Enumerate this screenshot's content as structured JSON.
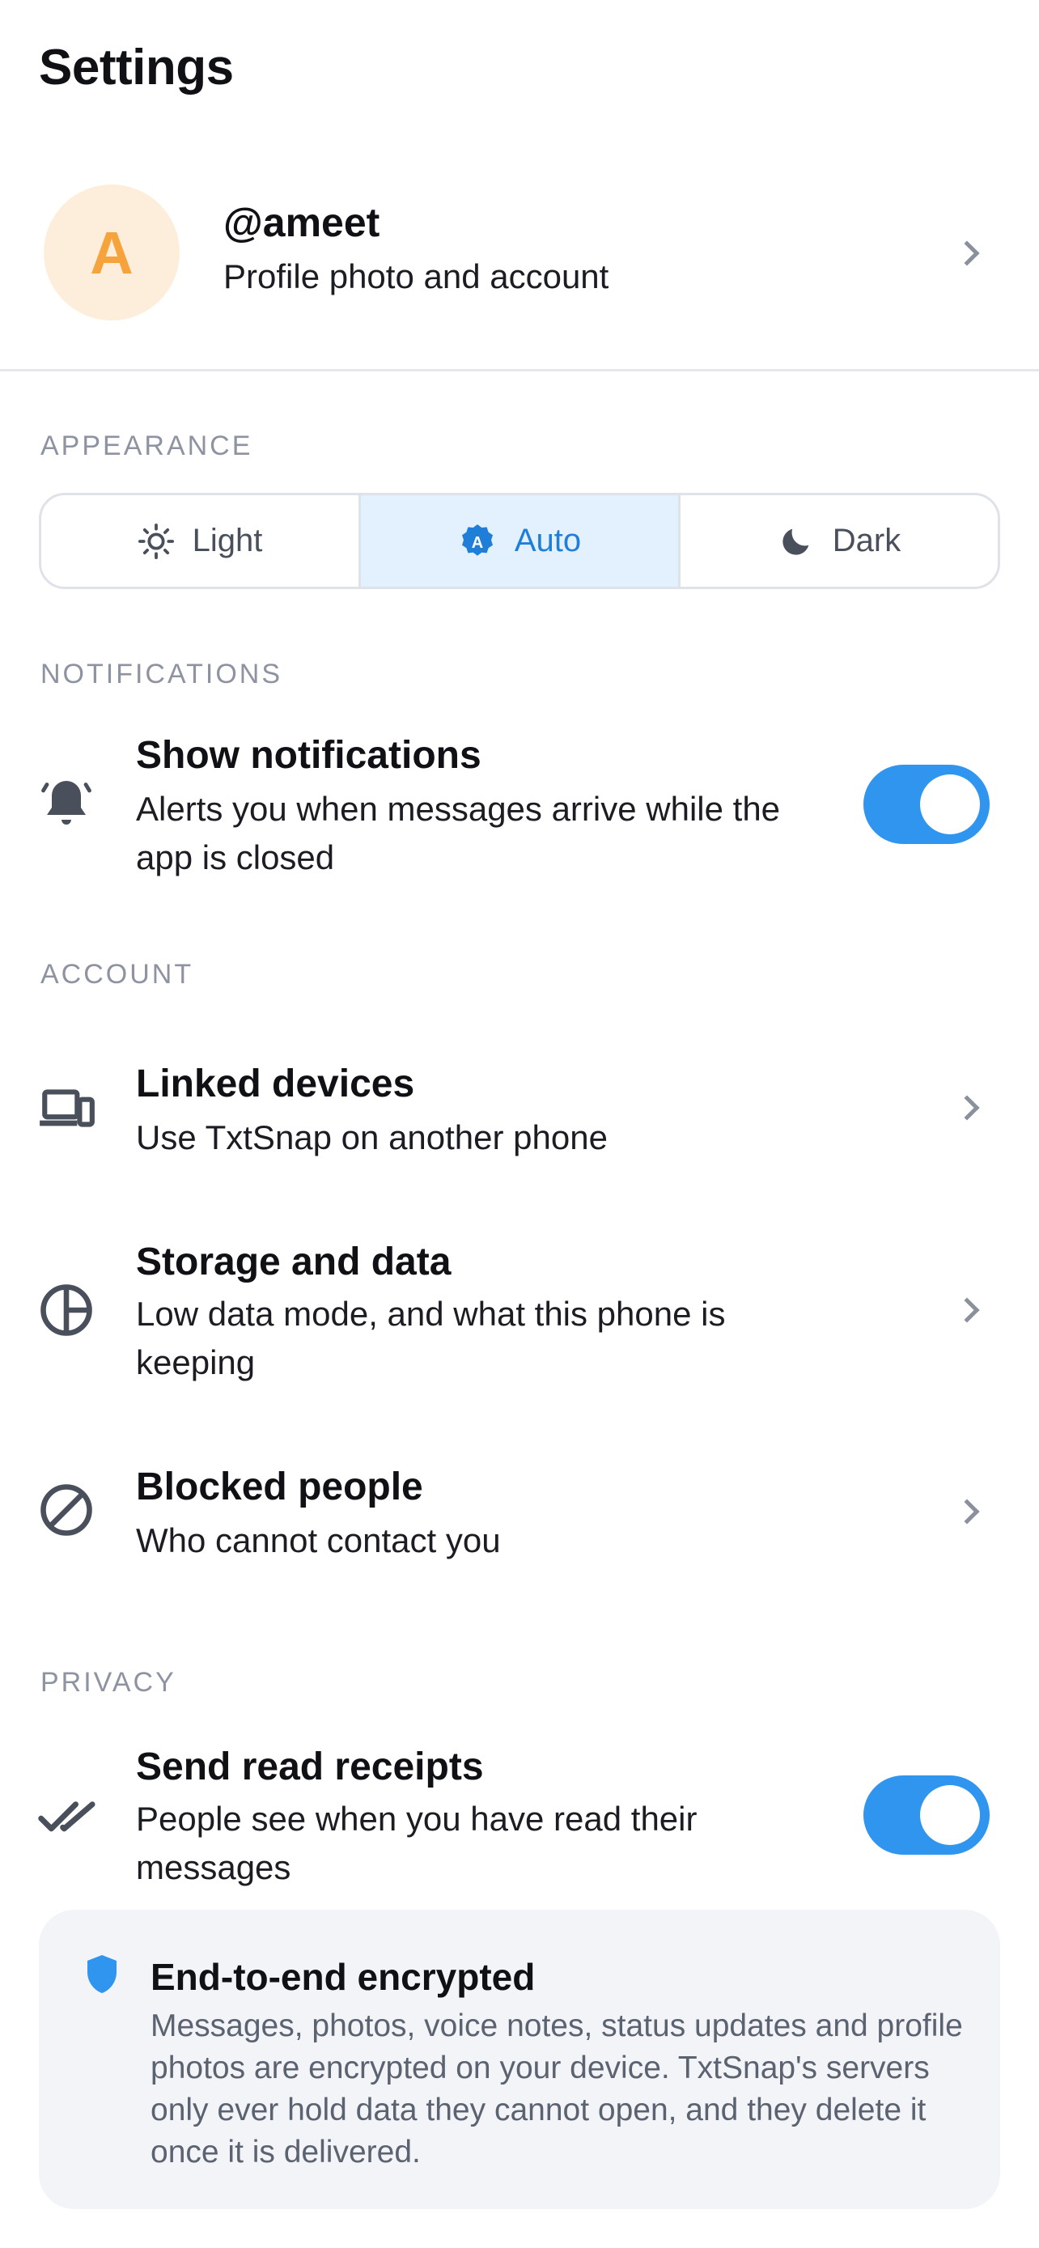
{
  "header": {
    "title": "Settings"
  },
  "profile": {
    "avatar_letter": "A",
    "username": "@ameet",
    "subtitle": "Profile photo and account"
  },
  "appearance": {
    "label": "APPEARANCE",
    "options": [
      {
        "label": "Light",
        "icon": "sun-icon"
      },
      {
        "label": "Auto",
        "icon": "auto-badge-icon",
        "selected": true
      },
      {
        "label": "Dark",
        "icon": "moon-icon"
      }
    ]
  },
  "notifications": {
    "label": "NOTIFICATIONS",
    "show": {
      "title": "Show notifications",
      "subtitle": "Alerts you when messages arrive while the app is closed",
      "enabled": true,
      "icon": "bell-icon"
    }
  },
  "account": {
    "label": "ACCOUNT",
    "items": [
      {
        "title": "Linked devices",
        "subtitle": "Use TxtSnap on another phone",
        "icon": "devices-icon"
      },
      {
        "title": "Storage and data",
        "subtitle": "Low data mode, and what this phone is keeping",
        "icon": "pie-chart-icon"
      },
      {
        "title": "Blocked people",
        "subtitle": "Who cannot contact you",
        "icon": "block-icon"
      }
    ]
  },
  "privacy": {
    "label": "PRIVACY",
    "read_receipts": {
      "title": "Send read receipts",
      "subtitle": "People see when you have read their messages",
      "enabled": true,
      "icon": "double-check-icon"
    }
  },
  "encryption": {
    "title": "End-to-end encrypted",
    "body": "Messages, photos, voice notes, status updates and profile photos are encrypted on your device. TxtSnap's servers only ever hold data they cannot open, and they delete it once it is delivered.",
    "icon": "shield-icon"
  },
  "colors": {
    "accent": "#2f95ef",
    "avatar_bg": "#fdeedc",
    "avatar_fg": "#f5a33a",
    "selected_segment": "#e3f0fd"
  }
}
